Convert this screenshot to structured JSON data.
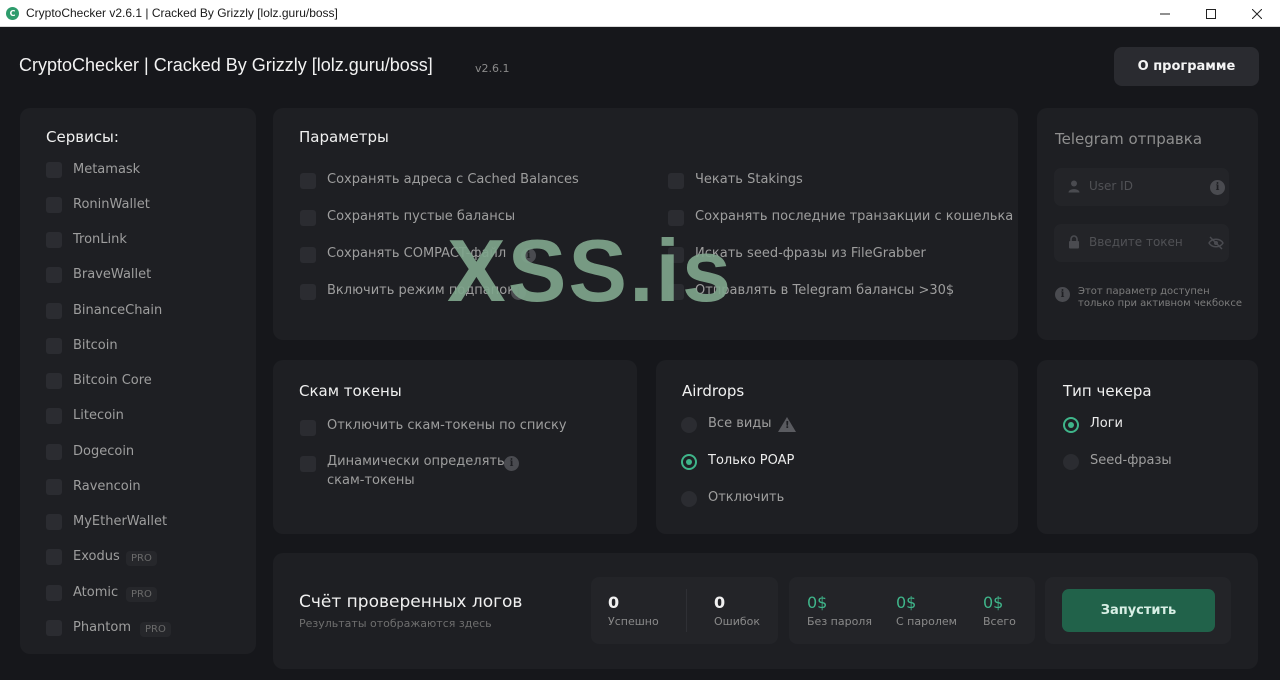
{
  "window": {
    "title": "CryptoChecker v2.6.1 | Cracked By Grizzly [lolz.guru/boss]",
    "icon_letter": "C"
  },
  "header": {
    "title": "CryptoChecker | Cracked By Grizzly [lolz.guru/boss]",
    "version": "v2.6.1",
    "about_label": "О программе"
  },
  "services": {
    "title": "Сервисы:",
    "items": [
      {
        "label": "Metamask"
      },
      {
        "label": "RoninWallet"
      },
      {
        "label": "TronLink"
      },
      {
        "label": "BraveWallet"
      },
      {
        "label": "BinanceChain"
      },
      {
        "label": "Bitcoin"
      },
      {
        "label": "Bitcoin Core"
      },
      {
        "label": "Litecoin"
      },
      {
        "label": "Dogecoin"
      },
      {
        "label": "Ravencoin"
      },
      {
        "label": "MyEtherWallet"
      },
      {
        "label": "Exodus",
        "badge": "PRO"
      },
      {
        "label": "Atomic",
        "badge": "PRO"
      },
      {
        "label": "Phantom",
        "badge": "PRO"
      }
    ]
  },
  "params": {
    "title": "Параметры",
    "left": [
      "Сохранять адреса с Cached Balances",
      "Сохранять пустые балансы",
      "Сохранять COMPACT-файл",
      "Включить режим подпапок"
    ],
    "right": [
      "Чекать Stakings",
      "Сохранять последние транзакции с кошелька",
      "Искать seed-фразы из FileGrabber",
      "Отправлять в Telegram балансы >30$"
    ]
  },
  "telegram": {
    "title": "Telegram отправка",
    "user_id_placeholder": "User ID",
    "token_placeholder": "Введите токен",
    "note_line1": "Этот параметр доступен",
    "note_line2": "только при активном чекбоксе"
  },
  "scam": {
    "title": "Скам токены",
    "opt1": "Отключить скам-токены по списку",
    "opt2_line1": "Динамически определять",
    "opt2_line2": "скам-токены"
  },
  "airdrops": {
    "title": "Airdrops",
    "options": [
      "Все виды",
      "Только POAP",
      "Отключить"
    ],
    "selected": "Только POAP"
  },
  "checker_type": {
    "title": "Тип чекера",
    "options": [
      "Логи",
      "Seed-фразы"
    ],
    "selected": "Логи"
  },
  "stats": {
    "title": "Счёт проверенных логов",
    "subtitle": "Результаты отображаются здесь",
    "success_value": "0",
    "success_label": "Успешно",
    "errors_value": "0",
    "errors_label": "Ошибок",
    "no_pass_value": "0$",
    "no_pass_label": "Без пароля",
    "with_pass_value": "0$",
    "with_pass_label": "С паролем",
    "total_value": "0$",
    "total_label": "Всего",
    "run_label": "Запустить"
  },
  "watermark": "XSS.is",
  "colors": {
    "accent": "#3fb58a",
    "run_button": "#21624a",
    "background": "#16171b",
    "panel": "#1e1f23"
  }
}
